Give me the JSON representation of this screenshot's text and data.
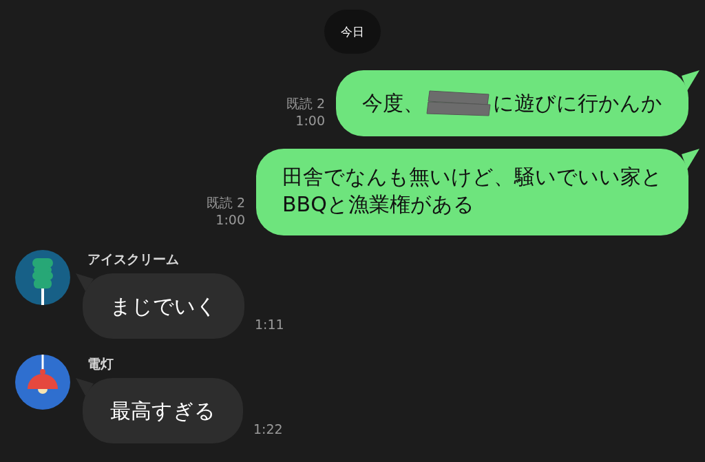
{
  "date_label": "今日",
  "messages": [
    {
      "kind": "sent",
      "parts": [
        {
          "kind": "text",
          "text": "今度、"
        },
        {
          "kind": "redaction"
        },
        {
          "kind": "text",
          "text": "に遊びに行かんか"
        }
      ],
      "read": "既読 2",
      "time": "1:00"
    },
    {
      "kind": "sent",
      "parts": [
        {
          "kind": "text",
          "text": "田舎でなんも無いけど、騒いでいい家と\nBBQと漁業権がある"
        }
      ],
      "read": "既読 2",
      "time": "1:00"
    },
    {
      "kind": "received",
      "sender": "アイスクリーム",
      "avatar": {
        "kind": "ice-candy"
      },
      "parts": [
        {
          "kind": "text",
          "text": "まじでいく"
        }
      ],
      "time": "1:11"
    },
    {
      "kind": "received",
      "sender": "電灯",
      "avatar": {
        "kind": "lamp"
      },
      "parts": [
        {
          "kind": "text",
          "text": "最高すぎる"
        }
      ],
      "time": "1:22"
    }
  ]
}
